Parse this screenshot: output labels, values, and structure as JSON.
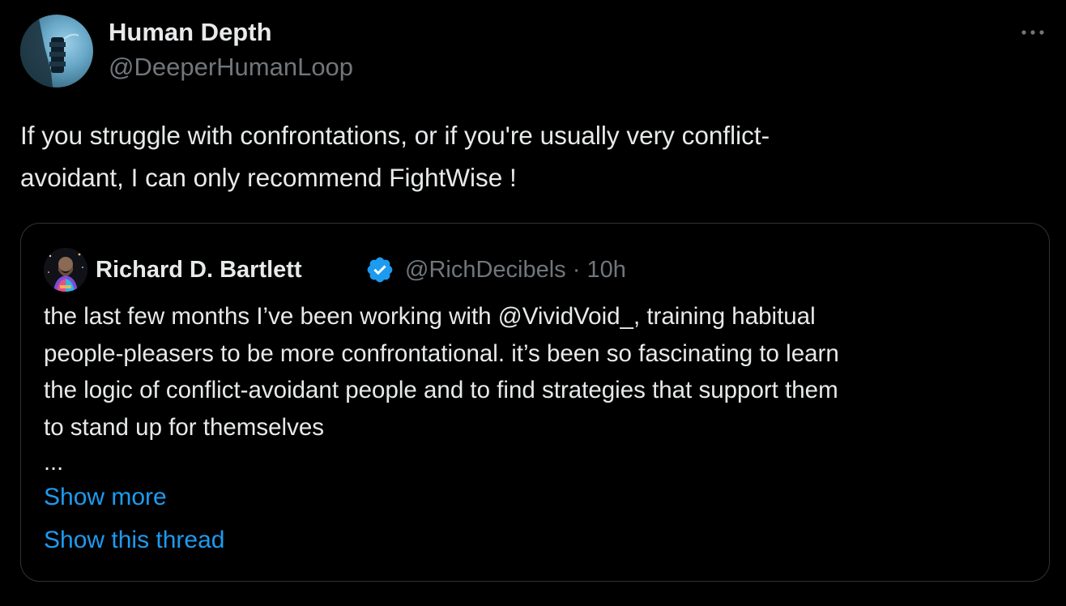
{
  "tweet": {
    "author": {
      "display_name": "Human Depth",
      "handle": "@DeeperHumanLoop"
    },
    "more_icon": "more-horizontal-icon",
    "text_lines": [
      "If you struggle with confrontations, or if you're usually very conflict-",
      "avoidant, I can only recommend FightWise !"
    ]
  },
  "quote": {
    "author": {
      "display_name": "Richard D. Bartlett",
      "verified_icon": "verified-badge-icon",
      "handle": "@RichDecibels",
      "separator": "·",
      "time": "10h"
    },
    "text_lines": [
      "the last few months I’ve been working with @VividVoid_, training habitual",
      "people-pleasers to be more confrontational. it’s been so fascinating to learn",
      "the logic of conflict-avoidant people and to find strategies that support them",
      "to stand up for themselves"
    ],
    "truncation": "...",
    "show_more_label": "Show more",
    "show_thread_label": "Show this thread"
  },
  "colors": {
    "background": "#000000",
    "text_primary": "#e7e9ea",
    "text_secondary": "#71767b",
    "accent": "#1d9bf0",
    "border": "#2f3336"
  }
}
